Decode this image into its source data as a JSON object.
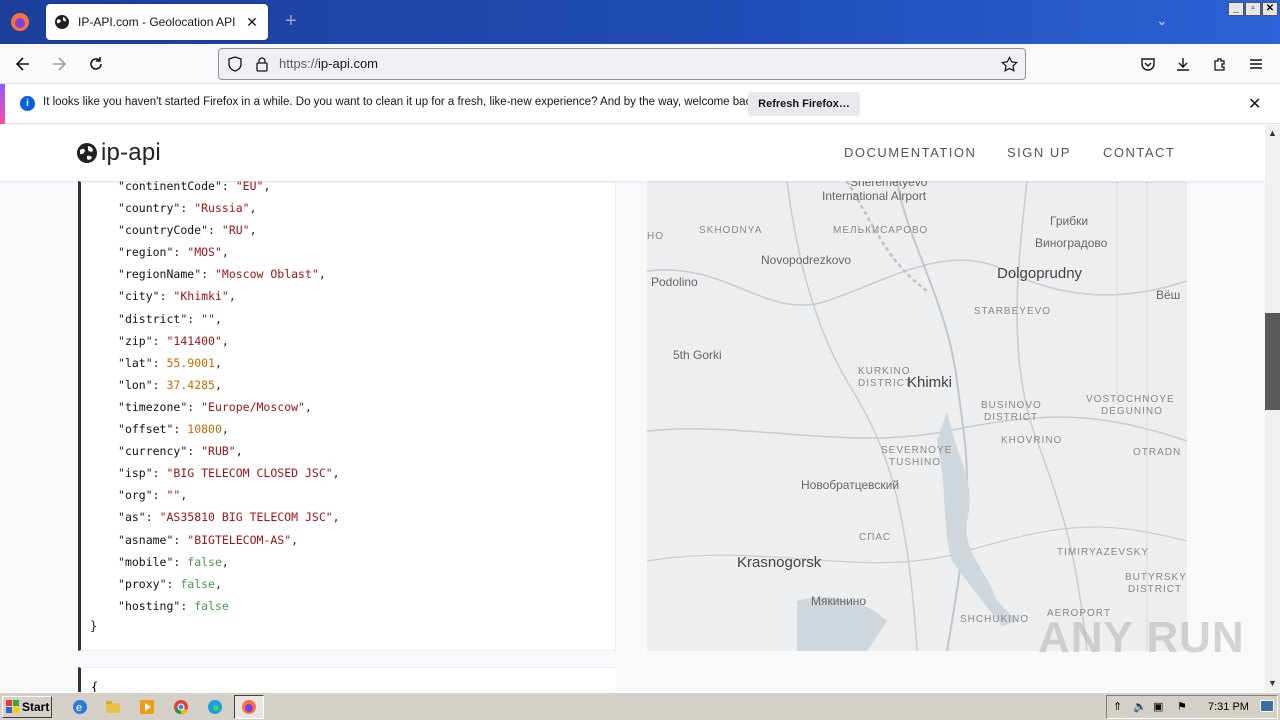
{
  "browser": {
    "tab_title": "IP-API.com - Geolocation API",
    "url_prefix": "https://",
    "url_host": "ip-api.com",
    "notification": {
      "message": "It looks like you haven't started Firefox in a while. Do you want to clean it up for a fresh, like-new experience? And by the way, welcome back!",
      "button": "Refresh Firefox…"
    }
  },
  "site": {
    "logo": "ip-api",
    "nav": [
      "DOCUMENTATION",
      "SIGN UP",
      "CONTACT"
    ]
  },
  "json_response": [
    {
      "key": "continentCode",
      "value": "\"EU\"",
      "type": "s",
      "comma": ","
    },
    {
      "key": "country",
      "value": "\"Russia\"",
      "type": "s",
      "comma": ","
    },
    {
      "key": "countryCode",
      "value": "\"RU\"",
      "type": "s",
      "comma": ","
    },
    {
      "key": "region",
      "value": "\"MOS\"",
      "type": "s",
      "comma": ","
    },
    {
      "key": "regionName",
      "value": "\"Moscow Oblast\"",
      "type": "s",
      "comma": ","
    },
    {
      "key": "city",
      "value": "\"Khimki\"",
      "type": "s",
      "comma": ","
    },
    {
      "key": "district",
      "value": "\"\"",
      "type": "s",
      "comma": ","
    },
    {
      "key": "zip",
      "value": "\"141400\"",
      "type": "s",
      "comma": ","
    },
    {
      "key": "lat",
      "value": "55.9001",
      "type": "n",
      "comma": ","
    },
    {
      "key": "lon",
      "value": "37.4285",
      "type": "n",
      "comma": ","
    },
    {
      "key": "timezone",
      "value": "\"Europe/Moscow\"",
      "type": "s",
      "comma": ","
    },
    {
      "key": "offset",
      "value": "10800",
      "type": "n",
      "comma": ","
    },
    {
      "key": "currency",
      "value": "\"RUB\"",
      "type": "s",
      "comma": ","
    },
    {
      "key": "isp",
      "value": "\"BIG TELECOM CLOSED JSC\"",
      "type": "s",
      "comma": ","
    },
    {
      "key": "org",
      "value": "\"\"",
      "type": "s",
      "comma": ","
    },
    {
      "key": "as",
      "value": "\"AS35810 BIG TELECOM JSC\"",
      "type": "s",
      "comma": ","
    },
    {
      "key": "asname",
      "value": "\"BIGTELECOM-AS\"",
      "type": "s",
      "comma": ","
    },
    {
      "key": "mobile",
      "value": "false",
      "type": "b",
      "comma": ","
    },
    {
      "key": "proxy",
      "value": "false",
      "type": "b",
      "comma": ","
    },
    {
      "key": "hosting",
      "value": "false",
      "type": "b",
      "comma": ""
    }
  ],
  "json_close": "}",
  "json_next_open": "{",
  "map_labels": [
    {
      "text": "Sheremetyevo",
      "cls": "mid"
    },
    {
      "text": "International Airport",
      "cls": "mid"
    },
    {
      "text": "SKHODNYA",
      "cls": "sm"
    },
    {
      "text": "МЕЛЬКИСАРОВО",
      "cls": "sm"
    },
    {
      "text": "Грибки",
      "cls": "mid"
    },
    {
      "text": "Виноградово",
      "cls": "mid"
    },
    {
      "text": "Novopodrezkovo",
      "cls": "mid"
    },
    {
      "text": "Dolgoprudny",
      "cls": "big"
    },
    {
      "text": "Podolino",
      "cls": "mid"
    },
    {
      "text": "Вёш",
      "cls": "mid"
    },
    {
      "text": "STARBEYEVO",
      "cls": "sm"
    },
    {
      "text": "5th Gorki",
      "cls": "mid"
    },
    {
      "text": "KURKINO",
      "cls": "sm"
    },
    {
      "text": "DISTRICT",
      "cls": "sm"
    },
    {
      "text": "Khimki",
      "cls": "big"
    },
    {
      "text": "VOSTOCHNOYE",
      "cls": "sm"
    },
    {
      "text": "BUSINOVO",
      "cls": "sm"
    },
    {
      "text": "DEGUNINO",
      "cls": "sm"
    },
    {
      "text": "DISTRICT",
      "cls": "sm"
    },
    {
      "text": "KHOVRINO",
      "cls": "sm"
    },
    {
      "text": "SEVERNOYE",
      "cls": "sm"
    },
    {
      "text": "TUSHINO",
      "cls": "sm"
    },
    {
      "text": "OTRADN",
      "cls": "sm"
    },
    {
      "text": "Новобратцевский",
      "cls": "mid"
    },
    {
      "text": "СПАС",
      "cls": "sm"
    },
    {
      "text": "TIMIRYAZEVSKY",
      "cls": "sm"
    },
    {
      "text": "Krasnogorsk",
      "cls": "big"
    },
    {
      "text": "BUTYRSKY",
      "cls": "sm"
    },
    {
      "text": "DISTRICT",
      "cls": "sm"
    },
    {
      "text": "Мякинино",
      "cls": "mid"
    },
    {
      "text": "AEROPORT",
      "cls": "sm"
    },
    {
      "text": "SHCHUKINO",
      "cls": "sm"
    },
    {
      "text": "НО",
      "cls": "sm"
    }
  ],
  "watermark": "ANY RUN",
  "taskbar": {
    "start": "Start",
    "clock": "7:31 PM"
  }
}
